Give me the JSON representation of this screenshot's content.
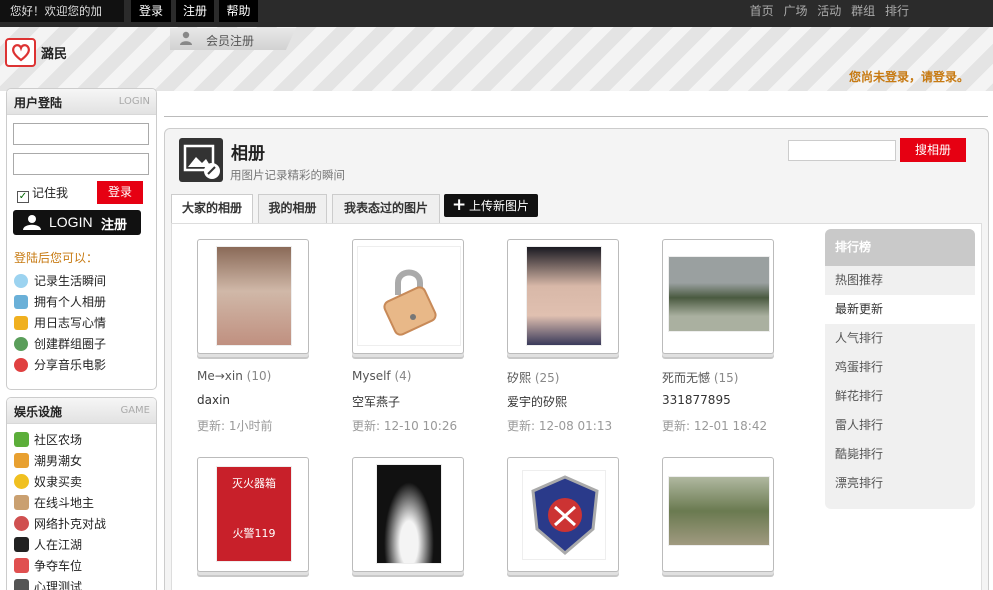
{
  "topbar": {
    "greeting": "您好！欢迎您的加入！",
    "login": "登录",
    "register": "注册",
    "help": "帮助",
    "nav": [
      "首页",
      "广场",
      "活动",
      "群组",
      "排行"
    ]
  },
  "header": {
    "site_name": "潞民",
    "register_tab": "会员注册",
    "not_logged_in": "您尚未登录，请登录。"
  },
  "login_box": {
    "title": "用户登陆",
    "title_en": "LOGIN",
    "remember": "记住我",
    "login_button": "登录",
    "big_button_en": "LOGIN",
    "big_button_cn": "注册",
    "after_login": "登陆后您可以：",
    "features": [
      "记录生活瞬间",
      "拥有个人相册",
      "用日志写心情",
      "创建群组圈子",
      "分享音乐电影"
    ]
  },
  "game_box": {
    "title": "娱乐设施",
    "title_en": "GAME",
    "items": [
      "社区农场",
      "潮男潮女",
      "奴隶买卖",
      "在线斗地主",
      "网络扑克对战",
      "人在江湖",
      "争夺车位",
      "心理测试"
    ]
  },
  "album": {
    "title": "相册",
    "subtitle": "用图片记录精彩的瞬间",
    "search_button": "搜相册",
    "tabs": [
      "大家的相册",
      "我的相册",
      "我表态过的图片"
    ],
    "upload": "上传新图片",
    "albums": [
      {
        "name": "Me→xin",
        "count": "(10)",
        "owner": "daxin",
        "updated": "更新: 1小时前"
      },
      {
        "name": "Myself",
        "count": "(4)",
        "owner": "空军燕子",
        "updated": "更新: 12-10 10:26"
      },
      {
        "name": "矽熙",
        "count": "(25)",
        "owner": "爱宇的矽熙",
        "updated": "更新: 12-08 01:13"
      },
      {
        "name": "死而无憾",
        "count": "(15)",
        "owner": "331877895",
        "updated": "更新: 12-01 18:42"
      }
    ],
    "second_row_photo_text": {
      "fire_box_title": "灭火器箱",
      "fire_box_sub": "火警119"
    }
  },
  "ranking": {
    "title": "排行榜",
    "items": [
      "热图推荐",
      "最新更新",
      "人气排行",
      "鸡蛋排行",
      "鲜花排行",
      "雷人排行",
      "酷毙排行",
      "漂亮排行"
    ]
  },
  "colors": {
    "accent_red": "#e60012",
    "orange_text": "#c77a12"
  }
}
